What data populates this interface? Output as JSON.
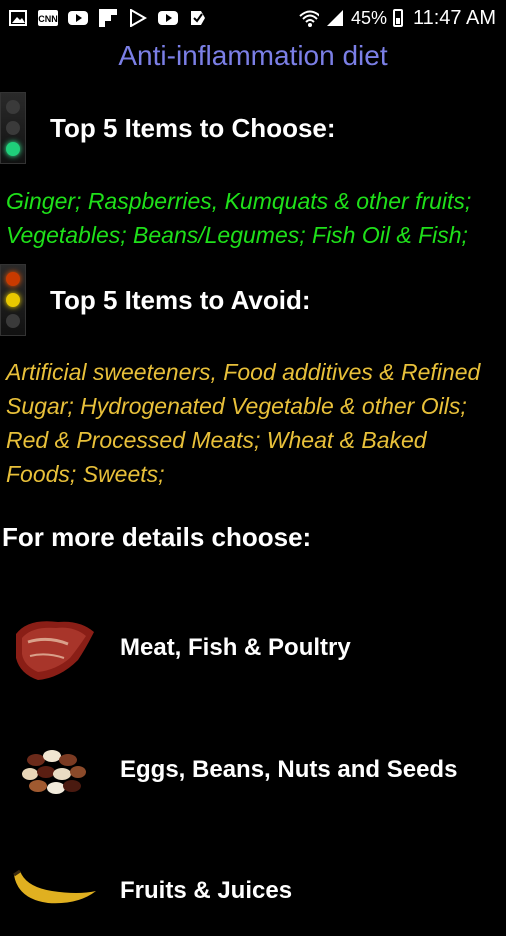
{
  "status_bar": {
    "battery": "45%",
    "time": "11:47 AM",
    "icons": [
      "gallery-icon",
      "cnn-icon",
      "youtube-icon",
      "flipboard-icon",
      "play-store-icon",
      "youtube-icon",
      "checkbox-icon",
      "wifi-icon",
      "signal-icon",
      "battery-icon"
    ]
  },
  "app": {
    "title": "Anti-inflammation diet"
  },
  "choose": {
    "heading": "Top 5 Items to Choose:",
    "text": "Ginger; Raspberries, Kumquats & other fruits; Vegetables; Beans/Legumes; Fish Oil & Fish;",
    "color": "#1fe01a"
  },
  "avoid": {
    "heading": "Top 5 Items to Avoid:",
    "text": "Artificial sweeteners, Food additives & Refined Sugar; Hydrogenated Vegetable & other Oils; Red & Processed Meats; Wheat & Baked Foods; Sweets;",
    "color": "#e8c03a"
  },
  "more_details": {
    "label": "For more details choose:"
  },
  "categories": [
    {
      "label": "Meat, Fish & Poultry",
      "icon": "steak-icon"
    },
    {
      "label": "Eggs, Beans, Nuts and Seeds",
      "icon": "beans-icon"
    },
    {
      "label": "Fruits & Juices",
      "icon": "banana-icon"
    }
  ]
}
